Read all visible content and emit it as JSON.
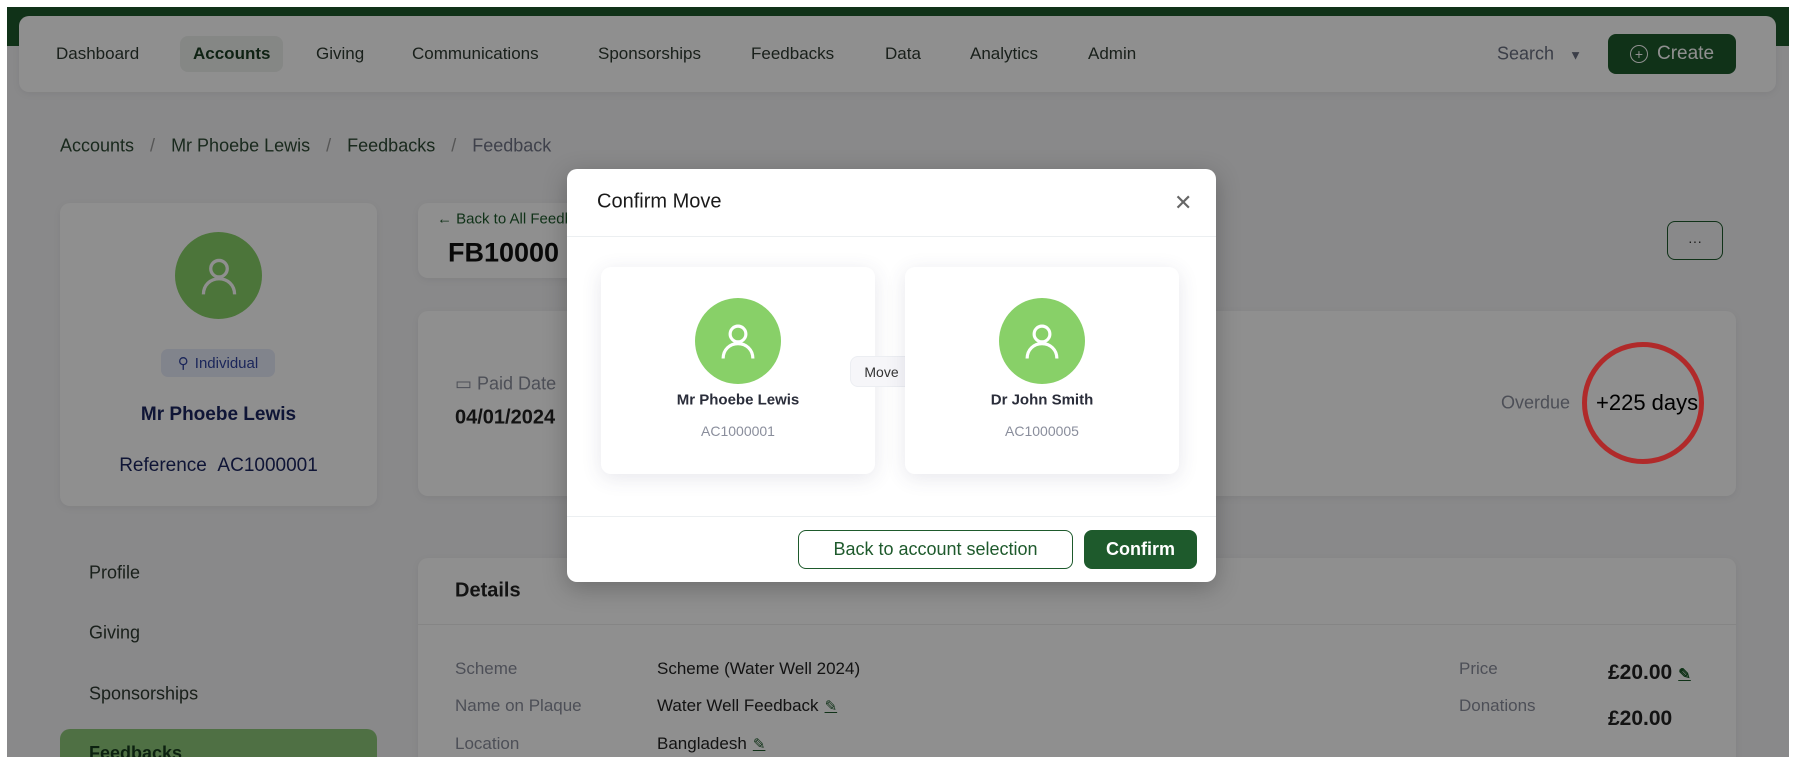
{
  "nav": {
    "items": [
      "Dashboard",
      "Accounts",
      "Giving",
      "Communications",
      "Sponsorships",
      "Feedbacks",
      "Data",
      "Analytics",
      "Admin"
    ],
    "active": "Accounts",
    "search_label": "Search",
    "create_label": "Create"
  },
  "breadcrumb": [
    "Accounts",
    "Mr Phoebe Lewis",
    "Feedbacks",
    "Feedback"
  ],
  "profile": {
    "type_badge": "Individual",
    "name": "Mr Phoebe Lewis",
    "reference_label": "Reference",
    "reference": "AC1000001"
  },
  "side_menu": [
    "Profile",
    "Giving",
    "Sponsorships",
    "Feedbacks"
  ],
  "feedback": {
    "back_link": "Back to All Feedbacks",
    "id": "FB10000",
    "more_label": "···"
  },
  "stats": {
    "paid_date_label": "Paid Date",
    "paid_date": "04/01/2024",
    "overdue_label": "Overdue",
    "overdue": "+225 days"
  },
  "details": {
    "title": "Details",
    "rows": [
      {
        "label": "Scheme",
        "value": "Scheme (Water Well 2024)"
      },
      {
        "label": "Name on Plaque",
        "value": "Water Well Feedback"
      },
      {
        "label": "Location",
        "value": "Bangladesh"
      }
    ],
    "price_label": "Price",
    "price": "£20.00",
    "donations_label": "Donations",
    "donations": "£20.00"
  },
  "modal": {
    "title": "Confirm Move",
    "from": {
      "name": "Mr Phoebe Lewis",
      "id": "AC1000001"
    },
    "move_label": "Move",
    "to": {
      "name": "Dr John Smith",
      "id": "AC1000005"
    },
    "back_label": "Back to account selection",
    "confirm_label": "Confirm"
  },
  "colors": {
    "brand": "#1e5a2c",
    "avatar": "#88d068",
    "highlight": "#b02a2a"
  }
}
